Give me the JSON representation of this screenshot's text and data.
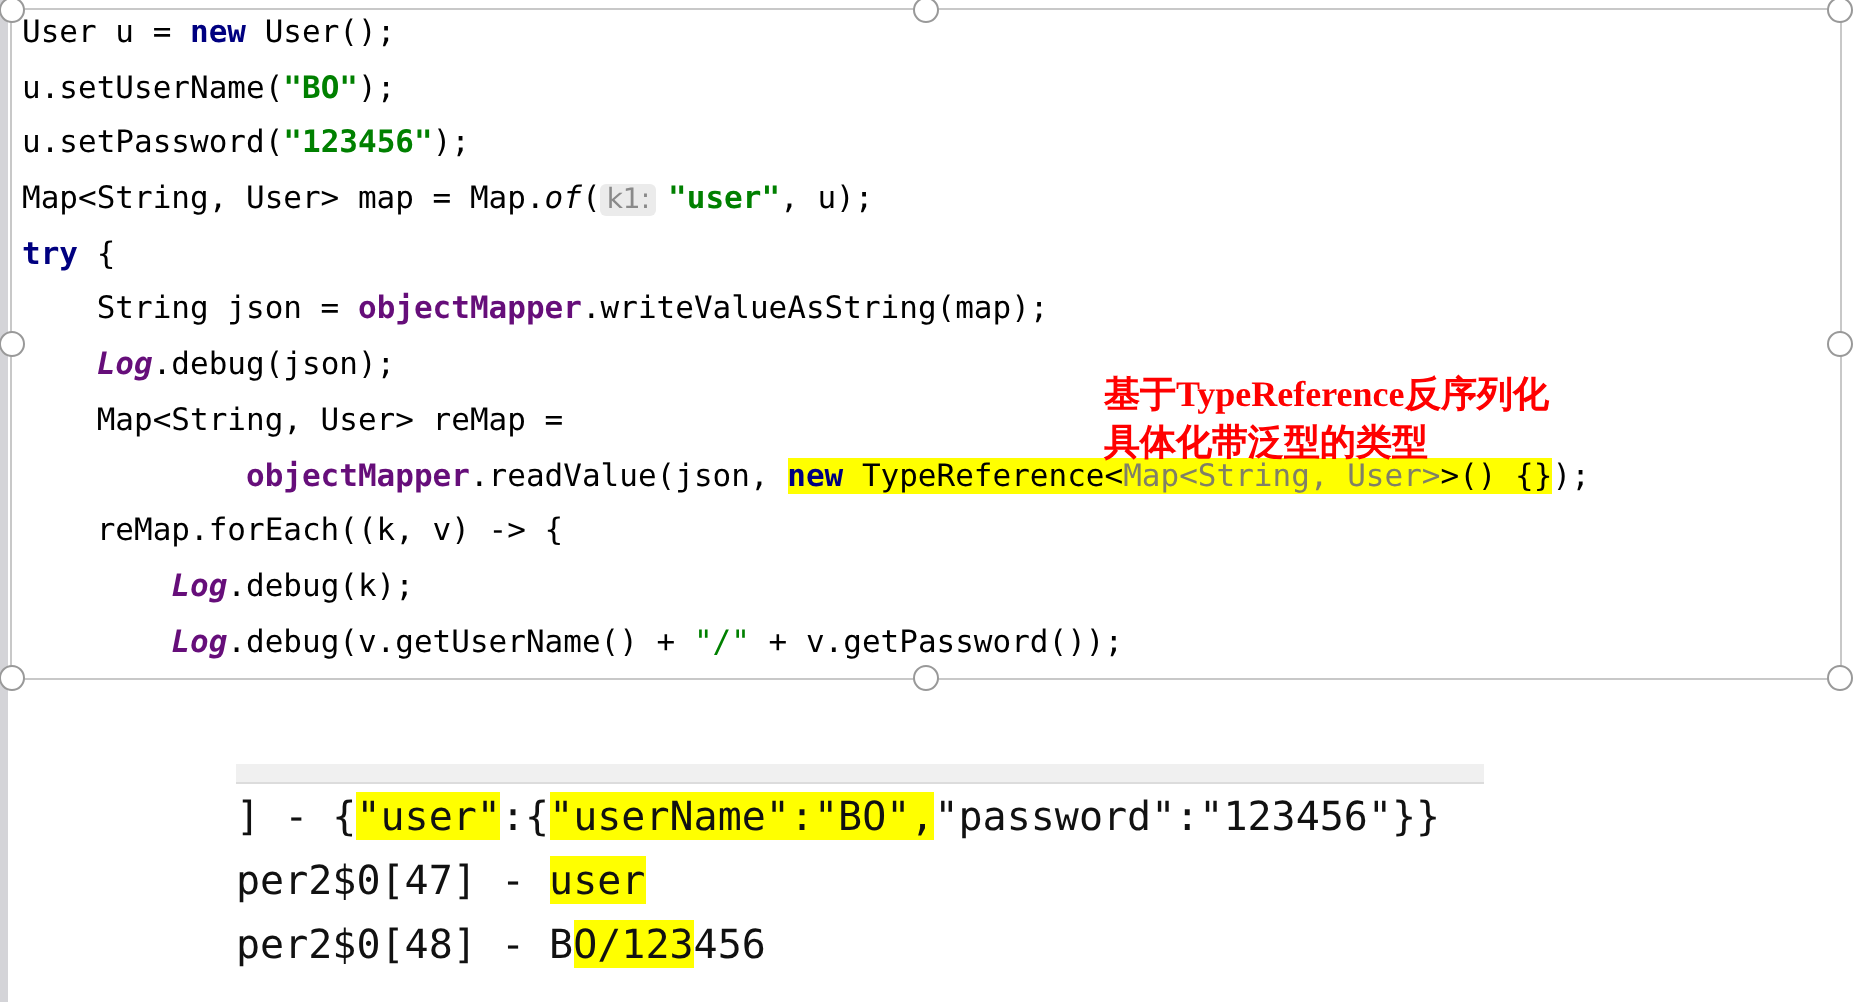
{
  "code_image": {
    "lines": [
      {
        "tokens": [
          {
            "text": "User u = ",
            "kind": "plain",
            "highlight": false
          },
          {
            "text": "new",
            "kind": "keyword",
            "highlight": false
          },
          {
            "text": " User();",
            "kind": "plain",
            "highlight": false
          }
        ]
      },
      {
        "tokens": [
          {
            "text": "u.setUserName(",
            "kind": "plain",
            "highlight": false
          },
          {
            "text": "\"BO\"",
            "kind": "string",
            "highlight": false
          },
          {
            "text": ");",
            "kind": "plain",
            "highlight": false
          }
        ]
      },
      {
        "tokens": [
          {
            "text": "u.setPassword(",
            "kind": "plain",
            "highlight": false
          },
          {
            "text": "\"123456\"",
            "kind": "string",
            "highlight": false
          },
          {
            "text": ");",
            "kind": "plain",
            "highlight": false
          }
        ]
      },
      {
        "tokens": [
          {
            "text": "Map<String, User> map = Map.",
            "kind": "plain",
            "highlight": false
          },
          {
            "text": "of",
            "kind": "italic",
            "highlight": false
          },
          {
            "text": "(",
            "kind": "plain",
            "highlight": false
          },
          {
            "text": "k1:",
            "kind": "hint",
            "highlight": false
          },
          {
            "text": "\"user\"",
            "kind": "string",
            "highlight": false
          },
          {
            "text": ", u);",
            "kind": "plain",
            "highlight": false
          }
        ]
      },
      {
        "tokens": [
          {
            "text": "try",
            "kind": "keyword",
            "highlight": false
          },
          {
            "text": " {",
            "kind": "plain",
            "highlight": false
          }
        ]
      },
      {
        "tokens": [
          {
            "text": "    String json = ",
            "kind": "plain",
            "highlight": false
          },
          {
            "text": "objectMapper",
            "kind": "field",
            "highlight": false
          },
          {
            "text": ".writeValueAsString(map);",
            "kind": "plain",
            "highlight": false
          }
        ]
      },
      {
        "tokens": [
          {
            "text": "    Log",
            "kind": "static",
            "highlight": false
          },
          {
            "text": ".debug(json);",
            "kind": "plain",
            "highlight": false
          }
        ]
      },
      {
        "tokens": [
          {
            "text": "    Map<String, User> reMap =",
            "kind": "plain",
            "highlight": false
          }
        ]
      },
      {
        "tokens": [
          {
            "text": "            objectMapper",
            "kind": "field",
            "highlight": false
          },
          {
            "text": ".readValue(json, ",
            "kind": "plain",
            "highlight": false
          },
          {
            "text": "new",
            "kind": "keyword",
            "highlight": true
          },
          {
            "text": " TypeReference<",
            "kind": "plain",
            "highlight": true
          },
          {
            "text": "Map<String, User>",
            "kind": "generic",
            "highlight": true
          },
          {
            "text": ">() {}",
            "kind": "plain",
            "highlight": true
          },
          {
            "text": ");",
            "kind": "plain",
            "highlight": false
          }
        ]
      },
      {
        "tokens": [
          {
            "text": "    reMap.forEach((k, v) -> {",
            "kind": "plain",
            "highlight": false
          }
        ]
      },
      {
        "tokens": [
          {
            "text": "        Log",
            "kind": "static",
            "highlight": false
          },
          {
            "text": ".debug(k);",
            "kind": "plain",
            "highlight": false
          }
        ]
      },
      {
        "tokens": [
          {
            "text": "        Log",
            "kind": "static",
            "highlight": false
          },
          {
            "text": ".debug(v.getUserName() + ",
            "kind": "plain",
            "highlight": false
          },
          {
            "text": "\"/\"",
            "kind": "string2",
            "highlight": false
          },
          {
            "text": " + v.getPassword());",
            "kind": "plain",
            "highlight": false
          }
        ]
      }
    ]
  },
  "annotation": {
    "lines": [
      "基于TypeReference反序列化",
      "具体化带泛型的类型"
    ]
  },
  "console_image": {
    "lines": [
      {
        "tokens": [
          {
            "text": "] - {",
            "highlight": false
          },
          {
            "text": "\"user\"",
            "highlight": true
          },
          {
            "text": ":{",
            "highlight": false
          },
          {
            "text": "\"userName\":\"BO\",",
            "highlight": true
          },
          {
            "text": "\"password\":\"123456\"}}",
            "highlight": false
          }
        ]
      },
      {
        "tokens": [
          {
            "text": "per2$0[47] - ",
            "highlight": false
          },
          {
            "text": "user",
            "highlight": true
          }
        ]
      },
      {
        "tokens": [
          {
            "text": "per2$0[48] - B",
            "highlight": false
          },
          {
            "text": "O/123",
            "highlight": true
          },
          {
            "text": "456",
            "highlight": false
          }
        ]
      }
    ]
  }
}
